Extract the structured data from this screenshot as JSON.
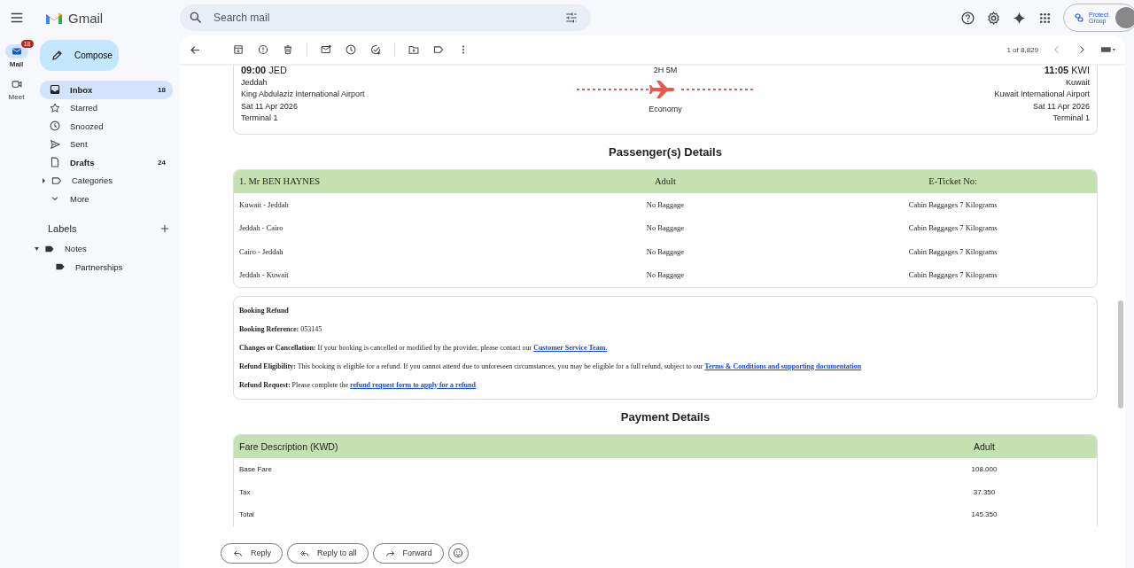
{
  "app": {
    "name": "Gmail"
  },
  "search": {
    "placeholder": "Search mail"
  },
  "account": {
    "org": "Protect Group"
  },
  "rail": [
    {
      "label": "Mail",
      "badge": "18",
      "selected": true
    },
    {
      "label": "Meet",
      "selected": false
    }
  ],
  "compose": "Compose",
  "folders": [
    {
      "kind": "folder",
      "label": "Inbox",
      "count": "18",
      "selected": true,
      "unread": true
    },
    {
      "kind": "folder",
      "label": "Starred",
      "selected": false,
      "unread": false
    },
    {
      "kind": "folder",
      "label": "Snoozed",
      "selected": false,
      "unread": false
    },
    {
      "kind": "folder",
      "label": "Sent",
      "selected": false,
      "unread": false
    },
    {
      "kind": "folder",
      "label": "Drafts",
      "count": "24",
      "selected": false,
      "unread": true
    },
    {
      "kind": "group",
      "label": "Categories",
      "selected": false,
      "unread": false,
      "expanded": false
    },
    {
      "kind": "more",
      "label": "More",
      "selected": false,
      "unread": false
    }
  ],
  "labels": {
    "title": "Labels",
    "items": [
      {
        "label": "Notes",
        "expanded": true,
        "children": [
          {
            "label": "Partnerships"
          }
        ]
      }
    ]
  },
  "toolbar": {
    "pagination": "1 of 8,829"
  },
  "flight": {
    "depart": {
      "time": "**09:00** JED",
      "city": "Jeddah",
      "airport": "King Abdulaziz International Airport",
      "date": "Sat 11 Apr 2026",
      "terminal": "Terminal 1"
    },
    "duration": "2H 5M",
    "cabin": "Economy",
    "arrive": {
      "time": "**11:05** KWI",
      "city": "Kuwait",
      "airport": "Kuwait International Airport",
      "date": "Sat 11 Apr 2026",
      "terminal": "Terminal 1"
    }
  },
  "passengers": {
    "title": "Passenger(s) Details",
    "header": [
      "1. Mr BEN HAYNES",
      "Adult",
      "E-Ticket No:"
    ],
    "rows": [
      [
        "Kuwait - Jeddah",
        "No Baggage",
        "Cabin Baggages 7 Kilograms"
      ],
      [
        "Jeddah - Cairo",
        "No Baggage",
        "Cabin Baggages 7 Kilograms"
      ],
      [
        "Cairo - Jeddah",
        "No Baggage",
        "Cabin Baggages 7 Kilograms"
      ],
      [
        "Jeddah - Kuwait",
        "No Baggage",
        "Cabin Baggages 7 Kilograms"
      ]
    ]
  },
  "refund": {
    "title": "Booking Refund",
    "paragraphs": [
      {
        "text": "**Booking Reference:** 053145"
      },
      {
        "text": "**Changes or Cancellation:** If your booking is cancelled or modified by the provider, please contact our",
        "link": "Customer Service Team."
      },
      {
        "text": "**Refund Eligibility:** This booking is eligible for a refund. If you cannot attend due to unforeseen circumstances, you may be eligible for a full refund, subject to our",
        "link": "Terms & Conditions and supporting documentation"
      },
      {
        "text": "**Refund Request:** Please complete the",
        "link": "refund request form to apply for a refund"
      }
    ]
  },
  "payment": {
    "title": "Payment Details",
    "columns": [
      "Fare Description (KWD)",
      "Adult"
    ],
    "rows": [
      [
        "Base Fare",
        "108.000"
      ],
      [
        "Tax",
        "37.350"
      ],
      [
        "Total",
        "145.350"
      ]
    ]
  },
  "reply_buttons": [
    "Reply",
    "Reply to all",
    "Forward"
  ]
}
